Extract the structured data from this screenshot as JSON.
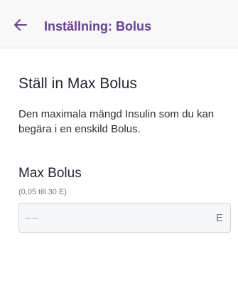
{
  "header": {
    "title": "Inställning: Bolus",
    "back_icon": "arrow-left-icon",
    "accent_color": "#6a3d9a"
  },
  "main": {
    "section_title": "Ställ in Max Bolus",
    "description": "Den maximala mängd Insulin som du kan begära i en enskild Bolus.",
    "field": {
      "label": "Max Bolus",
      "range": "(0,05 till 30 E)",
      "value": "",
      "placeholder": "––",
      "unit": "E"
    }
  }
}
